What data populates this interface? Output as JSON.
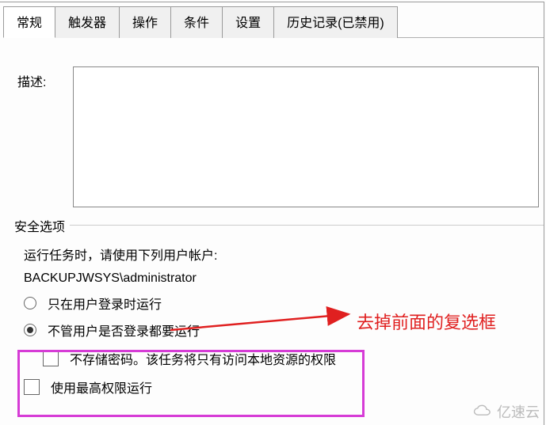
{
  "tabs": {
    "general": "常规",
    "triggers": "触发器",
    "actions": "操作",
    "conditions": "条件",
    "settings": "设置",
    "history": "历史记录(已禁用)"
  },
  "cutoff": {
    "label_fragment": ""
  },
  "description": {
    "label": "描述:",
    "value": ""
  },
  "security": {
    "legend": "安全选项",
    "run_as_prompt": "运行任务时，请使用下列用户帐户:",
    "account": "BACKUPJWSYS\\administrator",
    "radio_logged_on": "只在用户登录时运行",
    "radio_any": "不管用户是否登录都要运行",
    "chk_no_pwd": "不存储密码。该任务将只有访问本地资源的权限",
    "chk_highest": "使用最高权限运行"
  },
  "annotation": "去掉前面的复选框",
  "watermark": "亿速云"
}
